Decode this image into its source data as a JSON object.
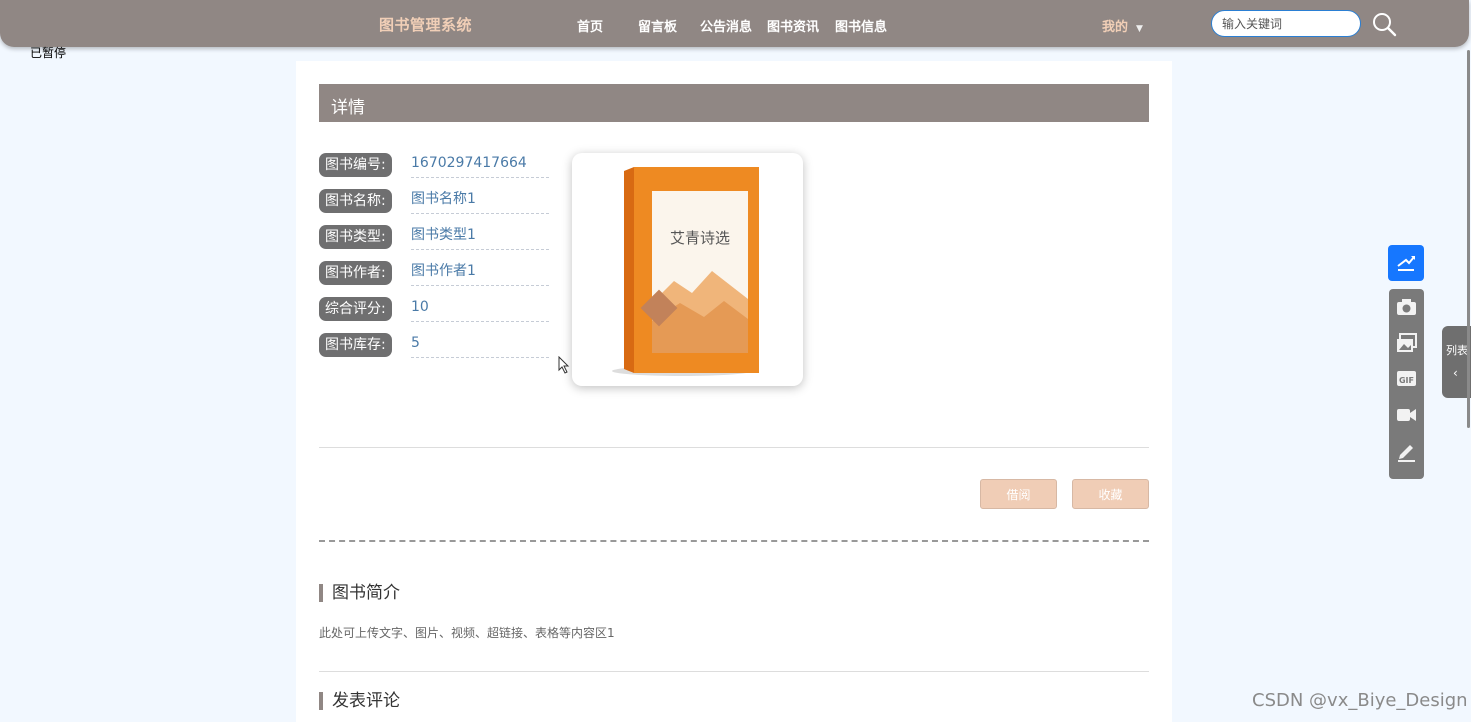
{
  "header": {
    "brand": "图书管理系统",
    "nav": [
      "首页",
      "留言板",
      "公告消息",
      "图书资讯",
      "图书信息"
    ],
    "user_menu": "我的",
    "search_placeholder": "输入关键词"
  },
  "status_overlay": "已暂停",
  "detail": {
    "section_title": "详情",
    "fields": [
      {
        "label": "图书编号:",
        "value": "1670297417664"
      },
      {
        "label": "图书名称:",
        "value": "图书名称1"
      },
      {
        "label": "图书类型:",
        "value": "图书类型1"
      },
      {
        "label": "图书作者:",
        "value": "图书作者1"
      },
      {
        "label": "综合评分:",
        "value": "10"
      },
      {
        "label": "图书库存:",
        "value": "5"
      }
    ],
    "cover": {
      "title": "艾青诗选"
    },
    "actions": {
      "borrow": "借阅",
      "favorite": "收藏"
    }
  },
  "intro": {
    "title": "图书简介",
    "text": "此处可上传文字、图片、视频、超链接、表格等内容区1"
  },
  "comment": {
    "title": "发表评论"
  },
  "side_panel": {
    "list_label": "列表"
  },
  "watermark": "CSDN @vx_Biye_Design",
  "colors": {
    "header_bg": "#908784",
    "brand": "#f1cfb7",
    "button_bg": "#f0cdb6",
    "link": "#4a7aa7",
    "share": "#1677ff"
  }
}
